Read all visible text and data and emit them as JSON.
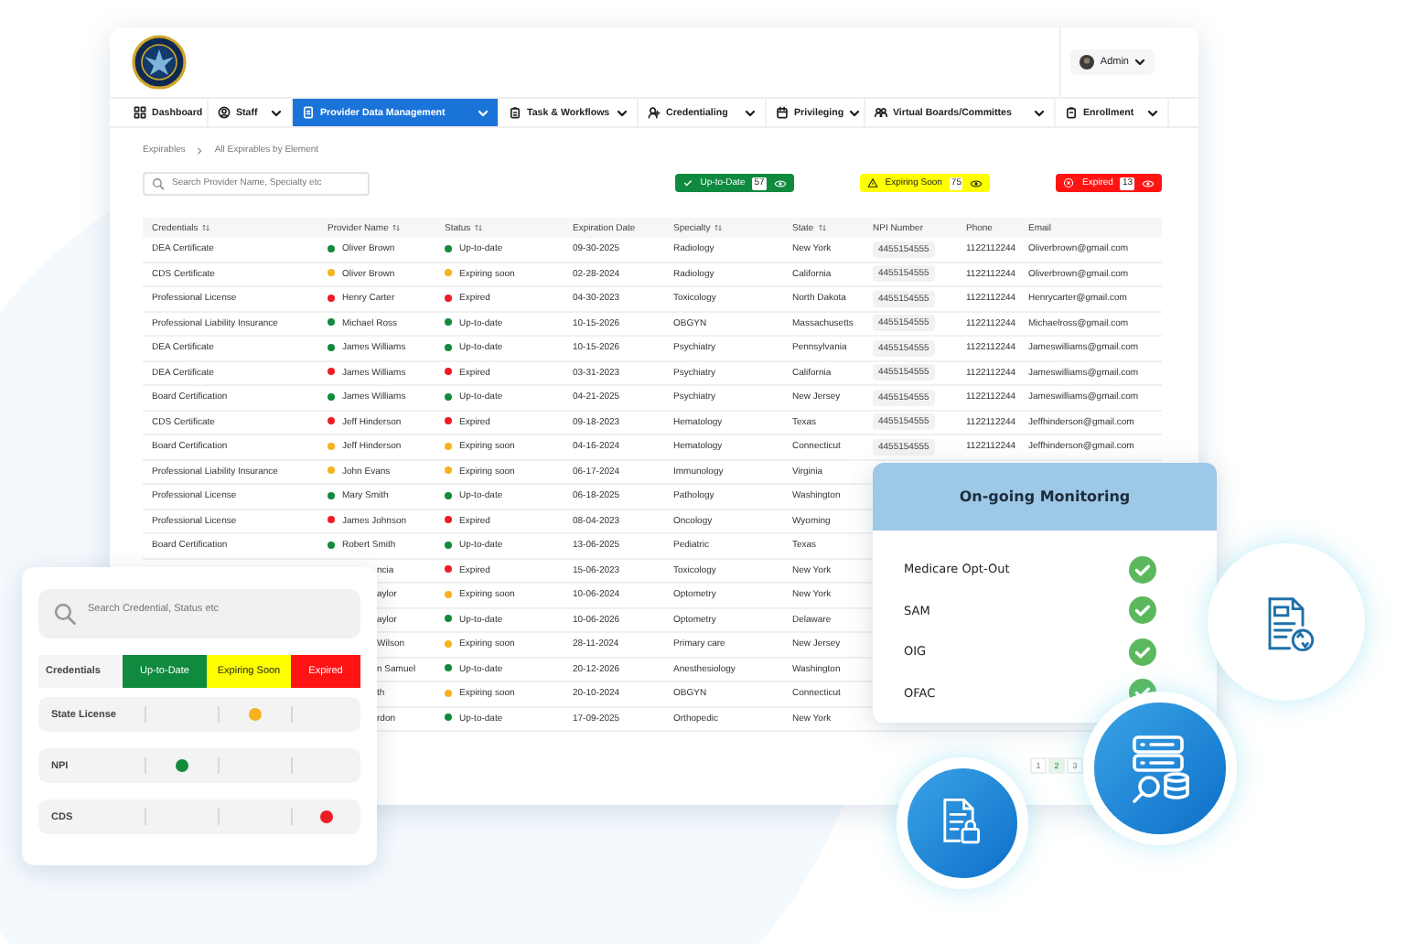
{
  "header": {
    "user": "Admin"
  },
  "nav": [
    {
      "label": "Dashboard",
      "selected": false,
      "has_menu": false
    },
    {
      "label": "Staff",
      "selected": false,
      "has_menu": true
    },
    {
      "label": "Provider Data Management",
      "selected": true,
      "has_menu": true
    },
    {
      "label": "Task & Workflows",
      "selected": false,
      "has_menu": true
    },
    {
      "label": "Credentialing",
      "selected": false,
      "has_menu": true
    },
    {
      "label": "Privileging",
      "selected": false,
      "has_menu": true
    },
    {
      "label": "Virtual Boards/Committes",
      "selected": false,
      "has_menu": true
    },
    {
      "label": "Enrollment",
      "selected": false,
      "has_menu": true
    }
  ],
  "breadcrumb": [
    "Expirables",
    "All Expirables by Element"
  ],
  "search": {
    "placeholder": "Search Provider Name, Specialty etc"
  },
  "summary": [
    {
      "label": "Up-to-Date",
      "count": "57",
      "color": "#0f8a3e"
    },
    {
      "label": "Expiring Soon",
      "count": "75",
      "color": "#ffff00"
    },
    {
      "label": "Expired",
      "count": "13",
      "color": "#ff1414"
    }
  ],
  "table": {
    "columns": [
      {
        "label": "Credentials",
        "sortable": true
      },
      {
        "label": "Provider Name",
        "sortable": true
      },
      {
        "label": "Status",
        "sortable": true
      },
      {
        "label": "Expiration Date",
        "sortable": false
      },
      {
        "label": "Specialty",
        "sortable": true
      },
      {
        "label": "State",
        "sortable": true
      },
      {
        "label": "NPI Number",
        "sortable": false
      },
      {
        "label": "Phone",
        "sortable": false
      },
      {
        "label": "Email",
        "sortable": false
      }
    ],
    "rows": [
      {
        "credential": "DEA Certificate",
        "provider": "Oliver Brown",
        "status": "Up-to-date",
        "color": "#138a3c",
        "expiration": "09-30-2025",
        "specialty": "Radiology",
        "state": "New York",
        "npi": "4455154555",
        "phone": "1122112244",
        "email": "Oliverbrown@gmail.com"
      },
      {
        "credential": "CDS Certificate",
        "provider": "Oliver Brown",
        "status": "Expiring soon",
        "color": "#f7b21f",
        "expiration": "02-28-2024",
        "specialty": "Radiology",
        "state": "California",
        "npi": "4455154555",
        "phone": "1122112244",
        "email": "Oliverbrown@gmail.com"
      },
      {
        "credential": "Professional License",
        "provider": "Henry Carter",
        "status": "Expired",
        "color": "#ee1c25",
        "expiration": "04-30-2023",
        "specialty": "Toxicology",
        "state": "North Dakota",
        "npi": "4455154555",
        "phone": "1122112244",
        "email": "Henrycarter@gmail.com"
      },
      {
        "credential": "Professional Liability Insurance",
        "provider": "Michael Ross",
        "status": "Up-to-date",
        "color": "#138a3c",
        "expiration": "10-15-2026",
        "specialty": "OBGYN",
        "state": "Massachusetts",
        "npi": "4455154555",
        "phone": "1122112244",
        "email": "Michaelross@gmail.com"
      },
      {
        "credential": "DEA Certificate",
        "provider": "James Williams",
        "status": "Up-to-date",
        "color": "#138a3c",
        "expiration": "10-15-2026",
        "specialty": "Psychiatry",
        "state": "Pennsylvania",
        "npi": "4455154555",
        "phone": "1122112244",
        "email": "Jameswilliams@gmail.com"
      },
      {
        "credential": "DEA Certificate",
        "provider": "James Williams",
        "status": "Expired",
        "color": "#ee1c25",
        "expiration": "03-31-2023",
        "specialty": "Psychiatry",
        "state": "California",
        "npi": "4455154555",
        "phone": "1122112244",
        "email": "Jameswilliams@gmail.com"
      },
      {
        "credential": "Board Certification",
        "provider": "James Williams",
        "status": "Up-to-date",
        "color": "#138a3c",
        "expiration": "04-21-2025",
        "specialty": "Psychiatry",
        "state": "New Jersey",
        "npi": "4455154555",
        "phone": "1122112244",
        "email": "Jameswilliams@gmail.com"
      },
      {
        "credential": "CDS Certificate",
        "provider": "Jeff Hinderson",
        "status": "Expired",
        "color": "#ee1c25",
        "expiration": "09-18-2023",
        "specialty": "Hematology",
        "state": "Texas",
        "npi": "4455154555",
        "phone": "1122112244",
        "email": "Jeffhinderson@gmail.com"
      },
      {
        "credential": "Board Certification",
        "provider": "Jeff Hinderson",
        "status": "Expiring soon",
        "color": "#f7b21f",
        "expiration": "04-16-2024",
        "specialty": "Hematology",
        "state": "Connecticut",
        "npi": "4455154555",
        "phone": "1122112244",
        "email": "Jeffhinderson@gmail.com"
      },
      {
        "credential": "Professional Liability Insurance",
        "provider": "John Evans",
        "status": "Expiring soon",
        "color": "#f7b21f",
        "expiration": "06-17-2024",
        "specialty": "Immunology",
        "state": "Virginia"
      },
      {
        "credential": "Professional License",
        "provider": "Mary Smith",
        "status": "Up-to-date",
        "color": "#138a3c",
        "expiration": "06-18-2025",
        "specialty": "Pathology",
        "state": "Washington"
      },
      {
        "credential": "Professional License",
        "provider": "James Johnson",
        "status": "Expired",
        "color": "#ee1c25",
        "expiration": "08-04-2023",
        "specialty": "Oncology",
        "state": "Wyoming"
      },
      {
        "credential": "Board Certification",
        "provider": "Robert Smith",
        "status": "Up-to-date",
        "color": "#138a3c",
        "expiration": "13-06-2025",
        "specialty": "Pediatric",
        "state": "Texas"
      },
      {
        "provider": "ncia",
        "status": "Expired",
        "color": "#ee1c25",
        "expiration": "15-06-2023",
        "specialty": "Toxicology",
        "state": "New York"
      },
      {
        "provider": "aylor",
        "status": "Expiring soon",
        "color": "#f7b21f",
        "expiration": "10-06-2024",
        "specialty": "Optometry",
        "state": "New York"
      },
      {
        "provider": "aylor",
        "status": "Up-to-date",
        "color": "#138a3c",
        "expiration": "10-06-2026",
        "specialty": "Optometry",
        "state": "Delaware"
      },
      {
        "provider": "Wilson",
        "status": "Expiring soon",
        "color": "#f7b21f",
        "expiration": "28-11-2024",
        "specialty": "Primary care",
        "state": "New Jersey"
      },
      {
        "provider": "n Samuel",
        "status": "Up-to-date",
        "color": "#138a3c",
        "expiration": "20-12-2026",
        "specialty": "Anesthesiology",
        "state": "Washington"
      },
      {
        "provider": "th",
        "status": "Expiring soon",
        "color": "#f7b21f",
        "expiration": "20-10-2024",
        "specialty": "OBGYN",
        "state": "Connecticut"
      },
      {
        "provider": "rdon",
        "status": "Up-to-date",
        "color": "#138a3c",
        "expiration": "17-09-2025",
        "specialty": "Orthopedic",
        "state": "New York"
      }
    ]
  },
  "pagination": [
    {
      "label": "1",
      "selected": false
    },
    {
      "label": "2",
      "selected": true
    },
    {
      "label": "3",
      "selected": false
    }
  ],
  "credential_card": {
    "search": {
      "placeholder": "Search Credential, Status etc"
    },
    "header": "Credentials",
    "legend": [
      {
        "label": "Up-to-Date",
        "color": "#0f8a3e"
      },
      {
        "label": "Expiring Soon",
        "color": "#ffff00"
      },
      {
        "label": "Expired",
        "color": "#ff1414"
      }
    ],
    "rows": [
      {
        "label": "State License",
        "cells": [
          {
            "marked": false
          },
          {
            "marked": true
          },
          {
            "marked": false
          }
        ]
      },
      {
        "label": "NPI",
        "cells": [
          {
            "marked": true
          },
          {
            "marked": false
          },
          {
            "marked": false
          }
        ]
      },
      {
        "label": "CDS",
        "cells": [
          {
            "marked": false
          },
          {
            "marked": false
          },
          {
            "marked": true
          }
        ]
      }
    ]
  },
  "monitoring": {
    "title": "On-going Monitoring",
    "items": [
      {
        "label": "Medicare Opt-Out",
        "checked": true
      },
      {
        "label": "SAM",
        "checked": true
      },
      {
        "label": "OIG",
        "checked": true
      },
      {
        "label": "OFAC",
        "checked": true
      }
    ]
  }
}
